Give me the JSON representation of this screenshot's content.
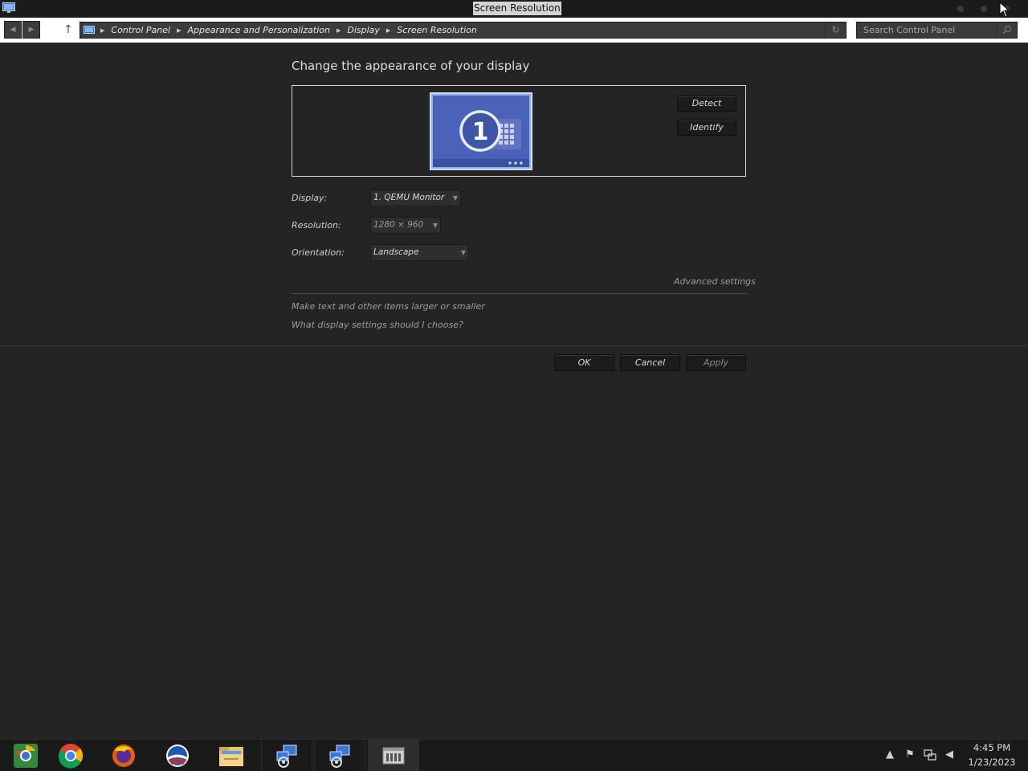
{
  "window": {
    "title": "Screen Resolution"
  },
  "breadcrumb": [
    "Control Panel",
    "Appearance and Personalization",
    "Display",
    "Screen Resolution"
  ],
  "search": {
    "placeholder": "Search Control Panel"
  },
  "main": {
    "heading": "Change the appearance of your display",
    "monitor_number": "1",
    "detect_label": "Detect",
    "identify_label": "Identify",
    "display_label": "Display:",
    "display_value": "1. QEMU Monitor",
    "resolution_label": "Resolution:",
    "resolution_value": "1280 × 960",
    "orientation_label": "Orientation:",
    "orientation_value": "Landscape",
    "advanced_link": "Advanced settings",
    "text_size_link": "Make text and other items larger or smaller",
    "help_link": "What display settings should I choose?",
    "ok_label": "OK",
    "cancel_label": "Cancel",
    "apply_label": "Apply"
  },
  "taskbar": {
    "items": [
      "chrome-canary-icon",
      "chrome-icon",
      "firefox-icon",
      "obama-campaign-icon",
      "file-explorer-icon",
      "network-settings-icon",
      "network-settings-icon",
      "control-panel-icon"
    ],
    "time": "4:45 PM",
    "date": "1/23/2023"
  },
  "colors": {
    "background": "#242424",
    "monitor_blue": "#4a62b8",
    "titlebar": "#1b1b1b"
  }
}
